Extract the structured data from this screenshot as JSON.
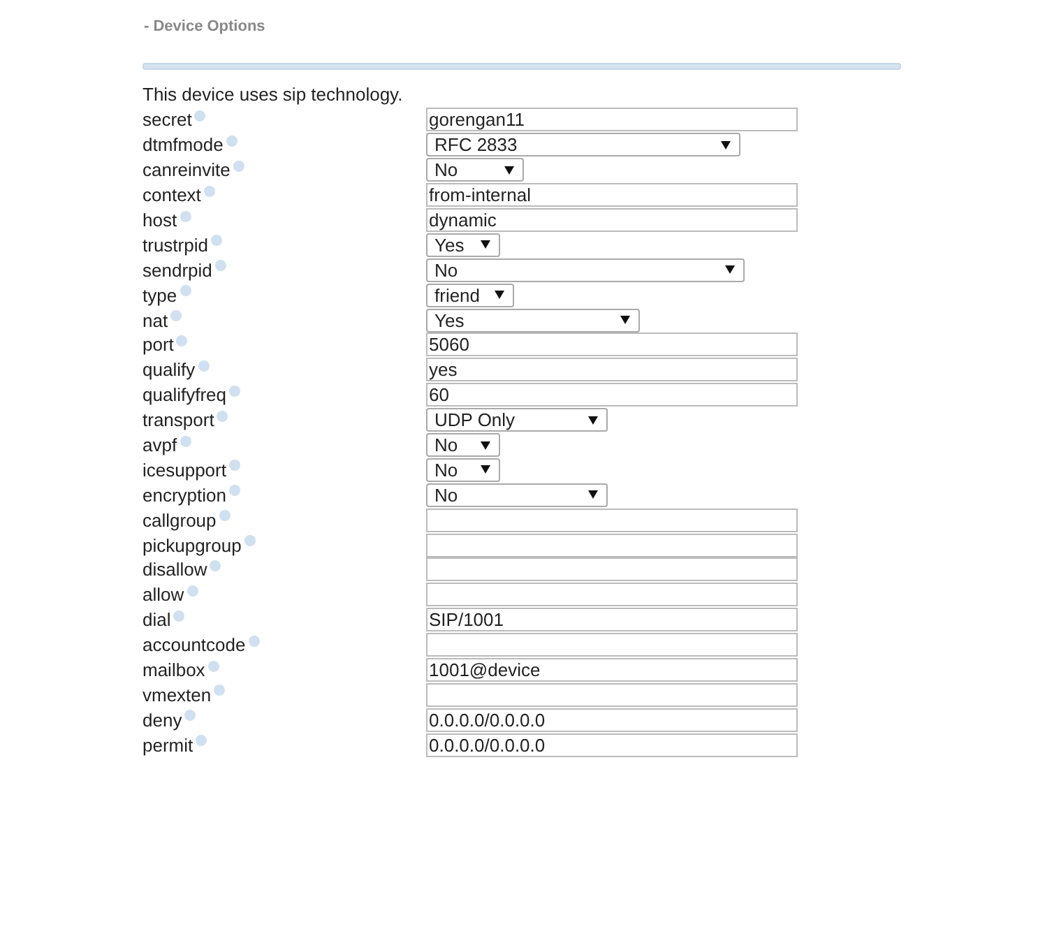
{
  "section_title": "- Device Options",
  "intro": "This device uses sip technology.",
  "fields": [
    {
      "label": "secret",
      "kind": "text",
      "value": "gorengan11"
    },
    {
      "label": "dtmfmode",
      "kind": "select",
      "value": "RFC 2833"
    },
    {
      "label": "canreinvite",
      "kind": "select",
      "value": "No"
    },
    {
      "label": "context",
      "kind": "text",
      "value": "from-internal"
    },
    {
      "label": "host",
      "kind": "text",
      "value": "dynamic"
    },
    {
      "label": "trustrpid",
      "kind": "select",
      "value": "Yes"
    },
    {
      "label": "sendrpid",
      "kind": "select",
      "value": "No"
    },
    {
      "label": "type",
      "kind": "select",
      "value": "friend"
    },
    {
      "label": "nat",
      "kind": "select",
      "value": "Yes"
    },
    {
      "label": "port",
      "kind": "text",
      "value": "5060"
    },
    {
      "label": "qualify",
      "kind": "text",
      "value": "yes"
    },
    {
      "label": "qualifyfreq",
      "kind": "text",
      "value": "60"
    },
    {
      "label": "transport",
      "kind": "select",
      "value": "UDP Only"
    },
    {
      "label": "avpf",
      "kind": "select",
      "value": "No"
    },
    {
      "label": "icesupport",
      "kind": "select",
      "value": "No"
    },
    {
      "label": "encryption",
      "kind": "select",
      "value": "No"
    },
    {
      "label": "callgroup",
      "kind": "text"
    },
    {
      "label": "pickupgroup",
      "kind": "text"
    },
    {
      "label": "disallow",
      "kind": "text"
    },
    {
      "label": "allow",
      "kind": "text"
    },
    {
      "label": "dial",
      "kind": "text",
      "value": "SIP/1001"
    },
    {
      "label": "accountcode",
      "kind": "text"
    },
    {
      "label": "mailbox",
      "kind": "text",
      "value": "1001@device"
    },
    {
      "label": "vmexten",
      "kind": "text"
    },
    {
      "label": "deny",
      "kind": "text",
      "value": "0.0.0.0/0.0.0.0"
    },
    {
      "label": "permit",
      "kind": "text",
      "value": "0.0.0.0/0.0.0.0"
    }
  ]
}
